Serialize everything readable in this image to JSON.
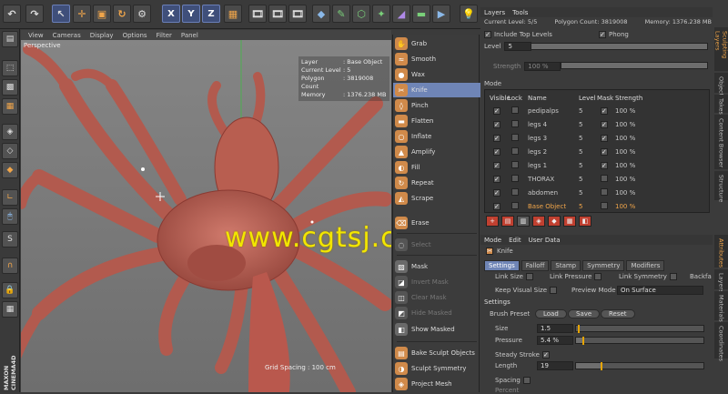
{
  "viewport_menu": [
    "View",
    "Cameras",
    "Display",
    "Options",
    "Filter",
    "Panel"
  ],
  "viewport": {
    "label": "Perspective",
    "hud": [
      {
        "k": "Layer",
        "v": ": Base Object"
      },
      {
        "k": "Current Level",
        "v": ": 5"
      },
      {
        "k": "Polygon Count",
        "v": ": 3819008"
      },
      {
        "k": "Memory",
        "v": ": 1376.238 MB"
      }
    ],
    "grid_spacing": "Grid Spacing : 100 cm",
    "watermark": "www.cgtsj.com"
  },
  "brand": {
    "maxon": "MAXON",
    "product": "CINEMA4D"
  },
  "toolbar": {
    "x": "X",
    "y": "Y",
    "z": "Z"
  },
  "tools": {
    "items": [
      "Grab",
      "Smooth",
      "Wax",
      "Knife",
      "Pinch",
      "Flatten",
      "Inflate",
      "Amplify",
      "Fill",
      "Repeat",
      "Scrape",
      "Erase"
    ],
    "select": "Select",
    "mask_items": [
      "Mask",
      "Invert Mask",
      "Clear Mask",
      "Hide Masked",
      "Show Masked"
    ],
    "bottom": [
      "Bake Sculpt Objects",
      "Sculpt Symmetry",
      "Project Mesh"
    ]
  },
  "layers_panel": {
    "tabs": [
      "Layers",
      "Tools"
    ],
    "current_level": "Current Level: 5/5",
    "polygon_count": "Polygon Count: 3819008",
    "memory": "Memory: 1376.238 MB",
    "include_top": "Include Top Levels",
    "phong": "Phong",
    "level_label": "Level",
    "level_value": "5",
    "strength_label": "Strength",
    "strength_value": "100 %",
    "mode_label": "Mode",
    "columns": [
      "Visible",
      "Lock",
      "Name",
      "Level",
      "Mask",
      "Strength"
    ],
    "rows": [
      {
        "name": "pedipalps",
        "level": "5",
        "strength": "100 %"
      },
      {
        "name": "legs 4",
        "level": "5",
        "strength": "100 %"
      },
      {
        "name": "legs 3",
        "level": "5",
        "strength": "100 %"
      },
      {
        "name": "legs 2",
        "level": "5",
        "strength": "100 %"
      },
      {
        "name": "legs 1",
        "level": "5",
        "strength": "100 %"
      },
      {
        "name": "THORAX",
        "level": "5",
        "strength": "100 %"
      },
      {
        "name": "abdomen",
        "level": "5",
        "strength": "100 %"
      },
      {
        "name": "Base Object",
        "level": "5",
        "strength": "100 %"
      }
    ]
  },
  "side_tabs_top": [
    "Sculpting Layers",
    "Objects",
    "Takes",
    "Content Browser",
    "Structure"
  ],
  "side_tabs_bottom": [
    "Attributes",
    "Layers",
    "Materials",
    "Coordinates"
  ],
  "attr_panel": {
    "menu": [
      "Mode",
      "Edit",
      "User Data"
    ],
    "tool_name": "Knife",
    "tabs": [
      "Settings",
      "Falloff",
      "Stamp",
      "Symmetry",
      "Modifiers"
    ],
    "link_size": "Link Size",
    "link_pressure": "Link Pressure",
    "link_symmetry": "Link Symmetry",
    "backface": "Backfa",
    "keep_visual": "Keep Visual Size",
    "preview_mode": "Preview Mode",
    "preview_value": "On Surface",
    "settings_header": "Settings",
    "brush_preset": "Brush Preset",
    "load": "Load",
    "save": "Save",
    "reset": "Reset",
    "size_label": "Size",
    "size_value": "1.5",
    "pressure_label": "Pressure",
    "pressure_value": "5.4 %",
    "steady": "Steady Stroke",
    "length_label": "Length",
    "length_value": "19",
    "spacing": "Spacing",
    "percent": "Percent"
  }
}
